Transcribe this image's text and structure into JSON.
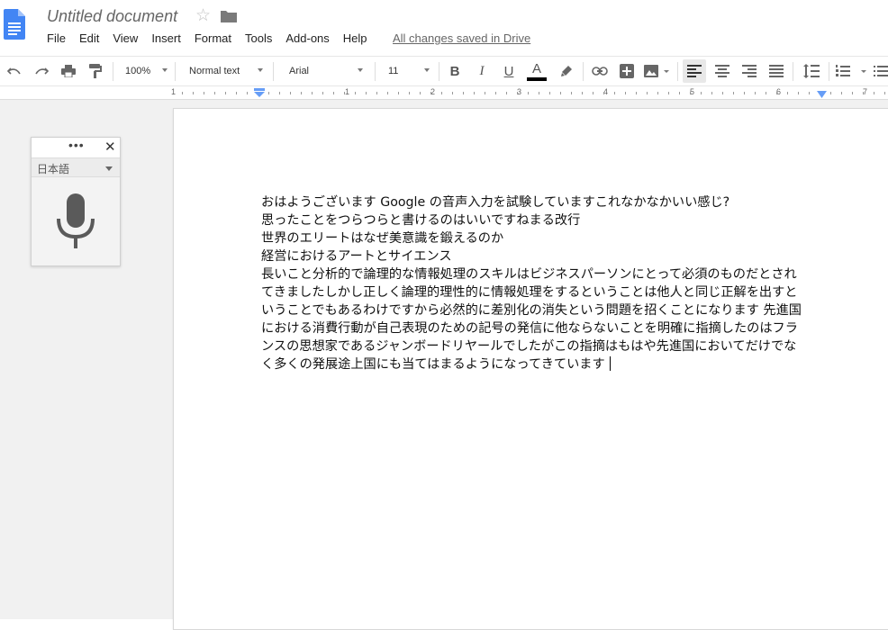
{
  "header": {
    "doc_title": "Untitled document",
    "save_status": "All changes saved in Drive",
    "menu": [
      "File",
      "Edit",
      "View",
      "Insert",
      "Format",
      "Tools",
      "Add-ons",
      "Help"
    ]
  },
  "toolbar": {
    "zoom": "100%",
    "style": "Normal text",
    "font": "Arial",
    "font_size": "11",
    "bold": "B",
    "italic": "I",
    "underline": "U",
    "text_color_letter": "A",
    "text_color": "#000000"
  },
  "ruler": {
    "numbers": [
      "1",
      "1",
      "2",
      "3",
      "4",
      "5",
      "6",
      "7"
    ]
  },
  "voice_panel": {
    "language": "日本語",
    "more": "•••",
    "close": "✕"
  },
  "document": {
    "lines": [
      "おはようございます Google の音声入力を試験していますこれなかなかいい感じ?",
      "思ったことをつらつらと書けるのはいいですねまる改行",
      "世界のエリートはなぜ美意識を鍛えるのか",
      "経営におけるアートとサイエンス",
      "長いこと分析的で論理的な情報処理のスキルはビジネスパーソンにとって必須のものだとされ",
      "てきましたしかし正しく論理的理性的に情報処理をするということは他人と同じ正解を出すと",
      "いうことでもあるわけですから必然的に差別化の消失という問題を招くことになります 先進国",
      "における消費行動が自己表現のための記号の発信に他ならないことを明確に指摘したのはフラ",
      "ンスの思想家であるジャンボードリヤールでしたがこの指摘はもはや先進国においてだけでな",
      "く多くの発展途上国にも当てはまるようになってきています"
    ]
  },
  "colors": {
    "docs_blue": "#4285f4",
    "ruler_marker": "#669df6",
    "canvas_bg": "#f1f1f1"
  }
}
